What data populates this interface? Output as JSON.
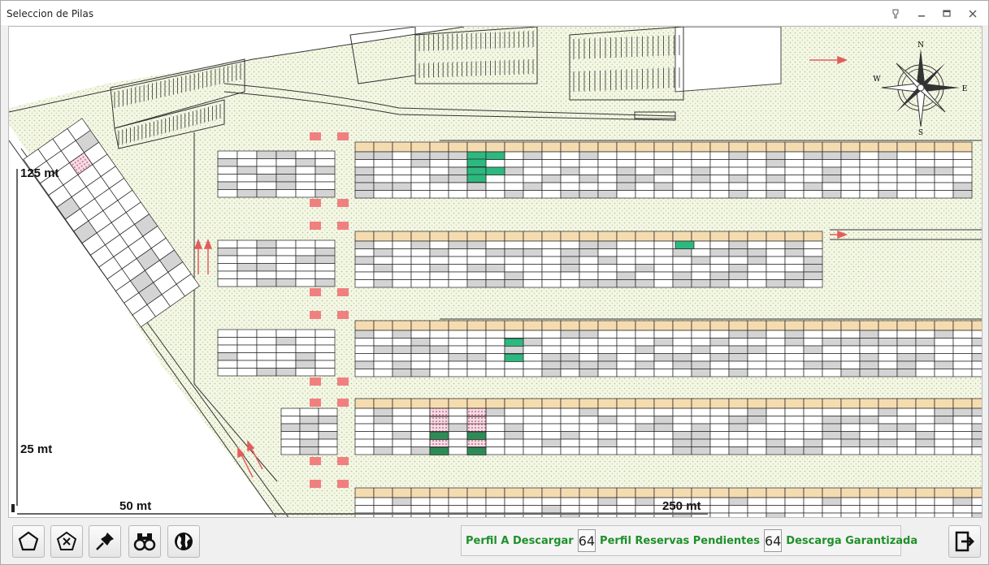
{
  "window": {
    "title": "Seleccion de Pilas"
  },
  "map": {
    "scale_labels": {
      "top": "125 mt",
      "mid": "25 mt",
      "bottom_left": "50 mt",
      "bottom_right": "250 mt"
    },
    "compass": {
      "n": "N",
      "s": "S",
      "e": "E",
      "w": "W"
    }
  },
  "toolbar": {
    "tools": [
      "polygon-icon",
      "polygon-remove-icon",
      "pin-icon",
      "binoculars-icon",
      "globe-icon"
    ]
  },
  "status": {
    "label1": "Perfil A Descargar",
    "value1": "64",
    "label2": "Perfil Reservas Pendientes",
    "value2": "64",
    "label3": "Descarga Garantizada"
  },
  "colors": {
    "green_fill": "#2db87f",
    "grey_fill": "#d4d4d4",
    "header_fill": "#f5dcb0",
    "marker": "#f08080",
    "map_bg": "#eef2dc",
    "status_text": "#1f8f2a"
  }
}
